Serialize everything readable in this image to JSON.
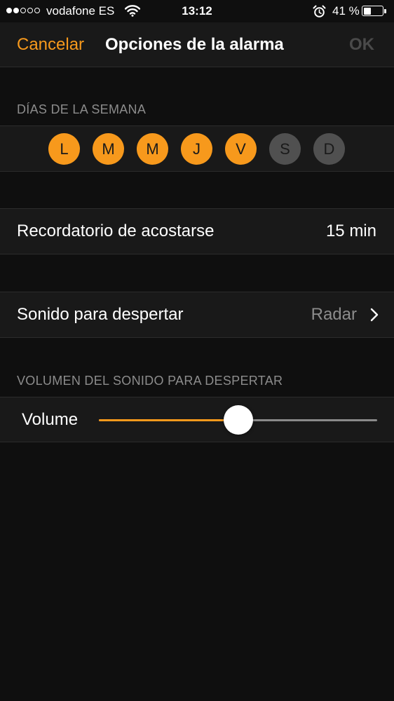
{
  "status_bar": {
    "carrier": "vodafone ES",
    "time": "13:12",
    "battery_percent": "41 %",
    "battery_level": 0.41,
    "signal_bars_filled": 2,
    "signal_bars_total": 5
  },
  "nav": {
    "cancel_label": "Cancelar",
    "title": "Opciones de la alarma",
    "ok_label": "OK"
  },
  "days_section": {
    "header": "DÍAS DE LA SEMANA",
    "days": [
      {
        "label": "L",
        "selected": true
      },
      {
        "label": "M",
        "selected": true
      },
      {
        "label": "M",
        "selected": true
      },
      {
        "label": "J",
        "selected": true
      },
      {
        "label": "V",
        "selected": true
      },
      {
        "label": "S",
        "selected": false
      },
      {
        "label": "D",
        "selected": false
      }
    ]
  },
  "bedtime_reminder": {
    "label": "Recordatorio de acostarse",
    "value": "15 min"
  },
  "wake_sound": {
    "label": "Sonido para despertar",
    "value": "Radar"
  },
  "volume_section": {
    "header": "VOLUMEN DEL SONIDO PARA DESPERTAR",
    "label": "Volume",
    "level": 0.5
  },
  "colors": {
    "accent": "#f7991c",
    "background": "#0f0f0f",
    "cell_background": "#191919",
    "secondary_text": "#8c8c8c",
    "disabled": "#4a4a4a"
  },
  "icons": {
    "wifi": "wifi-icon",
    "alarm": "alarm-clock-icon",
    "battery": "battery-icon",
    "chevron": "chevron-right-icon"
  }
}
